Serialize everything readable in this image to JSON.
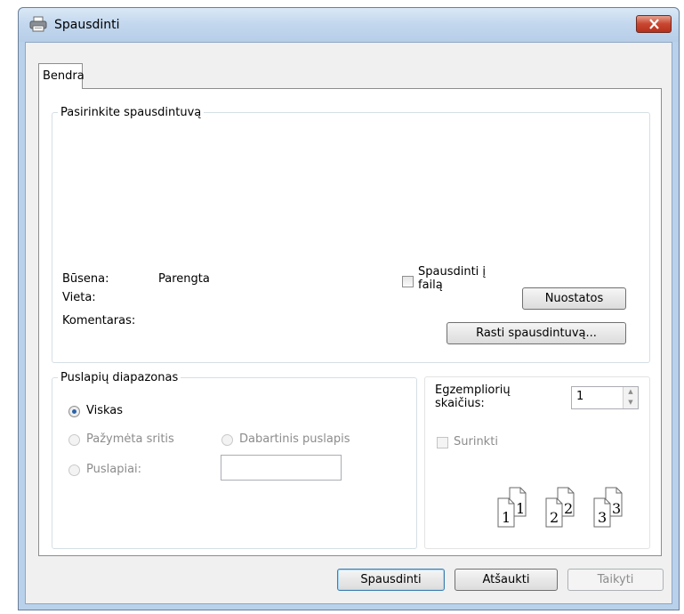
{
  "dialog": {
    "title": "Spausdinti",
    "icon": "printer-icon",
    "close_icon": "close-icon"
  },
  "tabs": [
    {
      "label": "Bendra",
      "selected": true
    }
  ],
  "printer_group": {
    "legend": "Pasirinkite spausdintuvą",
    "status_label": "Būsena:",
    "status_value": "Parengta",
    "location_label": "Vieta:",
    "comment_label": "Komentaras:",
    "print_to_file_label_line1": "Spausdinti į",
    "print_to_file_label_line2": "failą",
    "print_to_file_checked": false,
    "preferences_button": "Nuostatos",
    "find_printer_button": "Rasti spausdintuvą..."
  },
  "page_range": {
    "legend": "Puslapių diapazonas",
    "all_label": "Viskas",
    "selection_label": "Pažymėta sritis",
    "current_page_label": "Dabartinis puslapis",
    "pages_label": "Puslapiai:",
    "pages_value": "",
    "selected": "all"
  },
  "copies": {
    "label_line1": "Egzempliorių",
    "label_line2": "skaičius:",
    "value": "1",
    "collate_label": "Surinkti",
    "collate_checked": false,
    "collate_icon": "collate-pages-icon",
    "collate_page_numbers": [
      "1",
      "1",
      "2",
      "2",
      "3",
      "3"
    ]
  },
  "buttons": {
    "print": "Spausdinti",
    "cancel": "Atšaukti",
    "apply": "Taikyti"
  },
  "colors": {
    "title_bar": "#c3d8ee",
    "close_button": "#c8452f",
    "dialog_background": "#f0f0f0",
    "selected_radio": "#2a63a8"
  }
}
